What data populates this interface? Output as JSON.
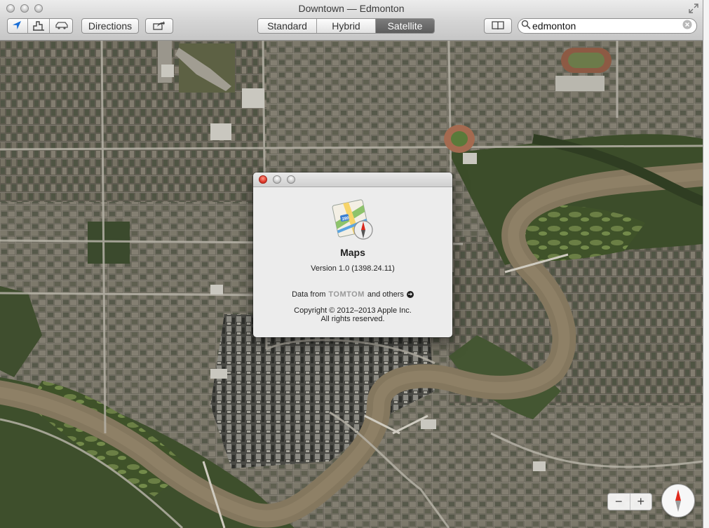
{
  "window": {
    "title": "Downtown — Edmonton"
  },
  "toolbar": {
    "directions_label": "Directions",
    "view_modes": [
      {
        "label": "Standard",
        "active": false
      },
      {
        "label": "Hybrid",
        "active": false
      },
      {
        "label": "Satellite",
        "active": true
      }
    ],
    "search_value": "edmonton"
  },
  "about": {
    "app_name": "Maps",
    "version": "Version 1.0 (1398.24.11)",
    "data_prefix": "Data from",
    "data_provider": "TOMTOM",
    "data_suffix": "and others",
    "copyright": "Copyright © 2012–2013 Apple Inc.",
    "rights": "All rights reserved."
  },
  "map_controls": {
    "zoom_out": "−",
    "zoom_in": "+"
  },
  "colors": {
    "river": "#85785f",
    "greenery": "#4d5e32",
    "urban": "#6f6c61",
    "accent_selected": "#676767"
  }
}
